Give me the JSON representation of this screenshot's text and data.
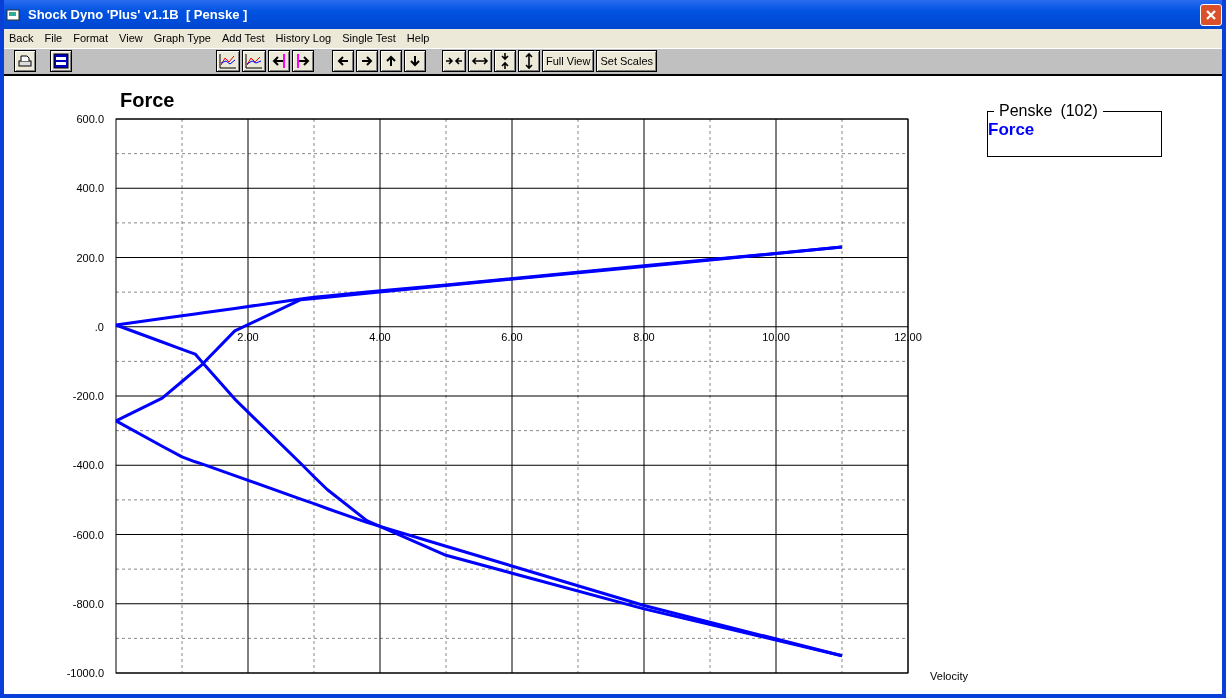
{
  "window": {
    "title": "Shock Dyno 'Plus' v1.1B  [ Penske ]"
  },
  "menu": [
    "Back",
    "File",
    "Format",
    "View",
    "Graph Type",
    "Add Test",
    "History Log",
    "Single Test",
    "Help"
  ],
  "toolbar": {
    "buttons": [
      "Full View",
      "Set Scales"
    ]
  },
  "chart_data": {
    "type": "line",
    "title": "Force",
    "xlabel": "Velocity",
    "xlim": [
      0,
      12
    ],
    "ylim": [
      -1000,
      600
    ],
    "grid": true,
    "xticks": [
      {
        "value": 2,
        "label": "2.00"
      },
      {
        "value": 4,
        "label": "4.00"
      },
      {
        "value": 6,
        "label": "6.00"
      },
      {
        "value": 8,
        "label": "8.00"
      },
      {
        "value": 10,
        "label": "10.00"
      },
      {
        "value": 12,
        "label": "12.00"
      }
    ],
    "yticks": [
      {
        "value": 600,
        "label": "600.0"
      },
      {
        "value": 400,
        "label": "400.0"
      },
      {
        "value": 200,
        "label": "200.0"
      },
      {
        "value": 0,
        "label": ".0"
      },
      {
        "value": -200,
        "label": "-200.0"
      },
      {
        "value": -400,
        "label": "-400.0"
      },
      {
        "value": -600,
        "label": "-600.0"
      },
      {
        "value": -800,
        "label": "-800.0"
      },
      {
        "value": -1000,
        "label": "-1000.0"
      }
    ],
    "x": [
      0,
      0.7,
      1,
      1.2,
      1.3,
      1.8,
      2.8,
      3,
      3.2,
      3.8,
      5,
      8,
      11
    ],
    "series": [
      {
        "name": "Force",
        "color": "#0000ff",
        "values": [
          5,
          24,
          32,
          37,
          40,
          53,
          80,
          85,
          89,
          100,
          121,
          176,
          230
        ]
      },
      {
        "color": "#0000ff",
        "values": [
          -272,
          -206,
          -158,
          -126,
          -110,
          -12,
          78,
          82,
          85,
          97,
          119,
          174,
          230
        ]
      },
      {
        "color": "#0000ff",
        "values": [
          -272,
          -345,
          -376,
          -390,
          -396,
          -430,
          -498,
          -511,
          -525,
          -565,
          -634,
          -805,
          -950
        ]
      },
      {
        "color": "#0000ff",
        "values": [
          5,
          -44,
          -65,
          -79,
          -101,
          -209,
          -395,
          -433,
          -470,
          -560,
          -660,
          -815,
          -950
        ]
      }
    ]
  },
  "legend": {
    "title": "Penske",
    "count": "(102)"
  }
}
